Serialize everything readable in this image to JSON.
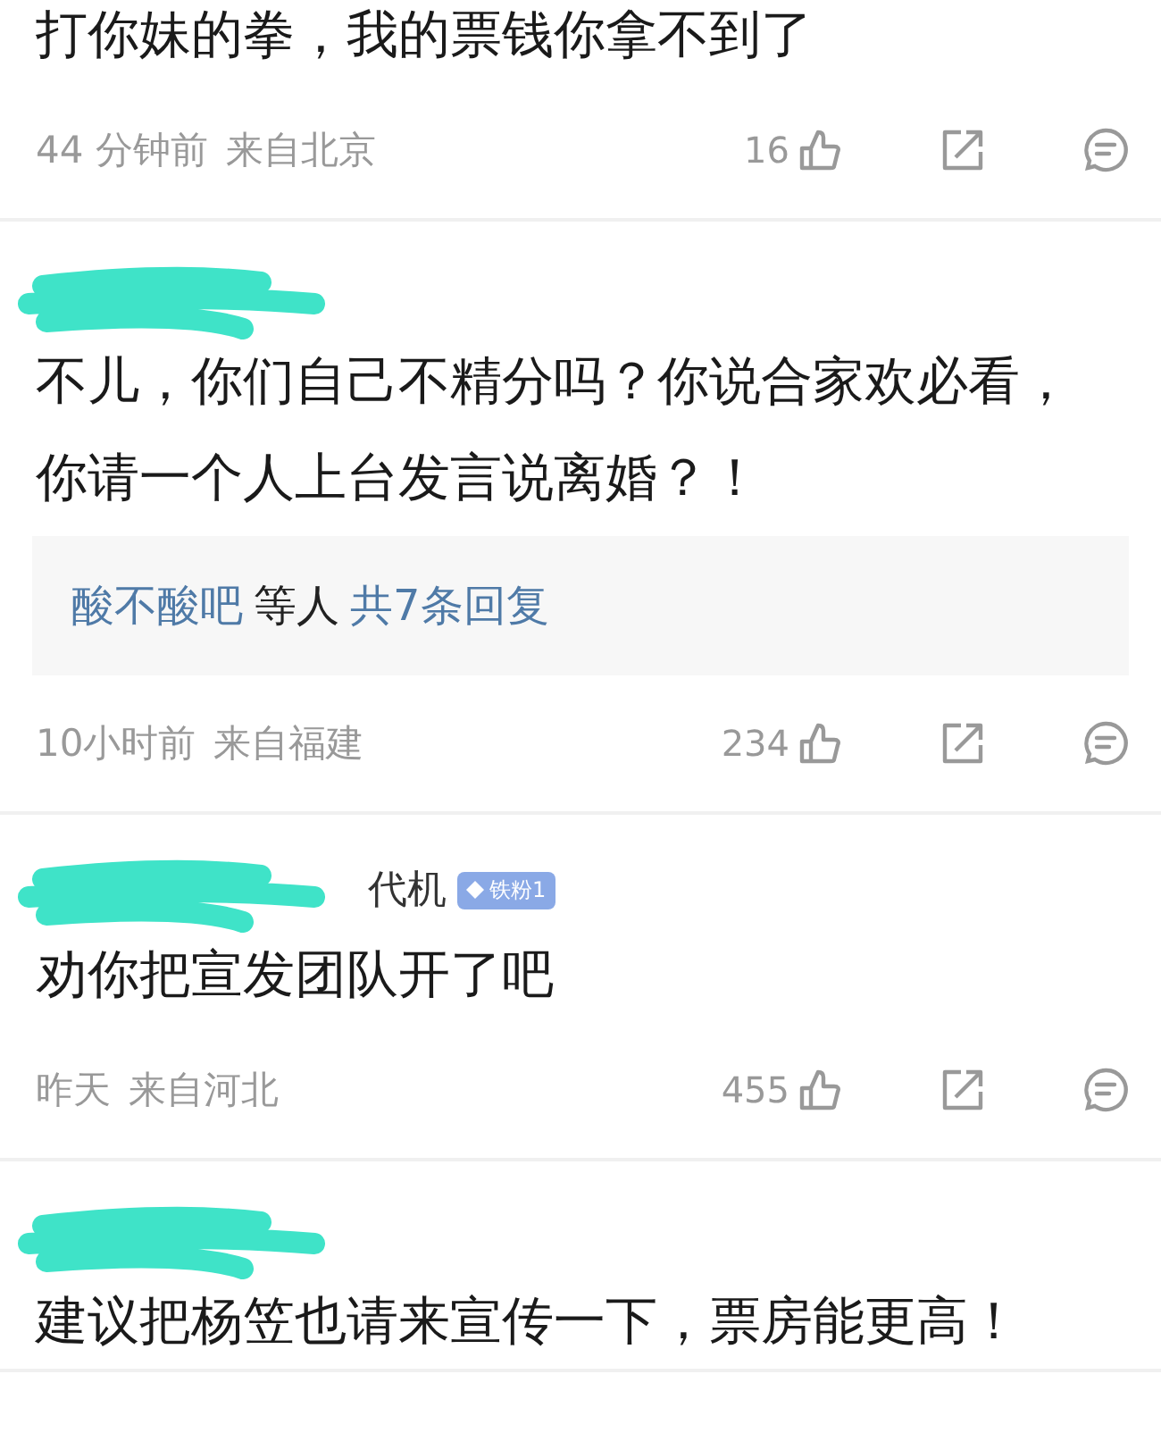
{
  "comments": [
    {
      "redacted": false,
      "lines": [
        "打你妹的拳，我的票钱你拿不到了"
      ],
      "time": "44 分钟前",
      "location": "来自北京",
      "likes": "16"
    },
    {
      "redacted": true,
      "lines": [
        "不儿，你们自己不精分吗？你说合家欢必看，",
        "你请一个人上台发言说离婚？！"
      ],
      "replies": {
        "names": "酸不酸吧",
        "middle": "等人",
        "count": "共7条回复"
      },
      "time": "10小时前",
      "location": "来自福建",
      "likes": "234"
    },
    {
      "redacted": true,
      "name": "代机",
      "badge": "铁粉1",
      "lines": [
        "劝你把宣发团队开了吧"
      ],
      "time": "昨天",
      "location": "来自河北",
      "likes": "455"
    },
    {
      "redacted": true,
      "lines": [
        "建议把杨笠也请来宣传一下，票房能更高！"
      ]
    }
  ]
}
